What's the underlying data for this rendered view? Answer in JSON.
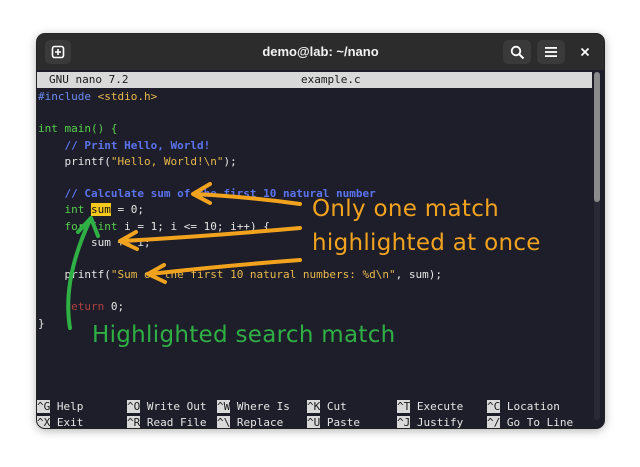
{
  "window": {
    "title": "demo@lab: ~/nano"
  },
  "titlebar_icons": {
    "new_tab": "new-tab-icon",
    "search": "search-icon",
    "menu": "hamburger-menu-icon",
    "close": "close-icon"
  },
  "nano": {
    "version": "GNU nano 7.2",
    "filename": "example.c"
  },
  "code": {
    "l1_a": "#include ",
    "l1_b": "<stdio.h>",
    "l3": "int main() {",
    "l4": "    // Print Hello, World!",
    "l5_a": "    printf(",
    "l5_b": "\"Hello, World!\\n\"",
    "l5_c": ");",
    "l7": "    // Calculate sum of the first 10 natural number",
    "l8_a": "    ",
    "l8_b": "int",
    "l8_c": " ",
    "l8_d": "sum",
    "l8_e": " = 0;",
    "l9_a": "    ",
    "l9_b": "for",
    "l9_c": " (",
    "l9_d": "int",
    "l9_e": " i = 1; i <= 10; i++) {",
    "l10": "        sum += i;",
    "l12_a": "    printf(",
    "l12_b": "\"Sum of the first 10 natural numbers: %d\\n\"",
    "l12_c": ", sum);",
    "l14_a": "    ",
    "l14_b": "return",
    "l14_c": " 0;",
    "l15": "}"
  },
  "shortcuts": {
    "row1": [
      {
        "key": "^G",
        "label": "Help"
      },
      {
        "key": "^O",
        "label": "Write Out"
      },
      {
        "key": "^W",
        "label": "Where Is"
      },
      {
        "key": "^K",
        "label": "Cut"
      },
      {
        "key": "^T",
        "label": "Execute"
      },
      {
        "key": "^C",
        "label": "Location"
      }
    ],
    "row2": [
      {
        "key": "^X",
        "label": "Exit"
      },
      {
        "key": "^R",
        "label": "Read File"
      },
      {
        "key": "^\\",
        "label": "Replace"
      },
      {
        "key": "^U",
        "label": "Paste"
      },
      {
        "key": "^J",
        "label": "Justify"
      },
      {
        "key": "^/",
        "label": "Go To Line"
      }
    ]
  },
  "annotations": {
    "line1": "Only one match",
    "line2": "highlighted at once",
    "bottom": "Highlighted search match"
  },
  "colors": {
    "orange_annotation": "#f2a31e",
    "green_annotation": "#2fb044",
    "search_highlight": "#f6c81d"
  }
}
